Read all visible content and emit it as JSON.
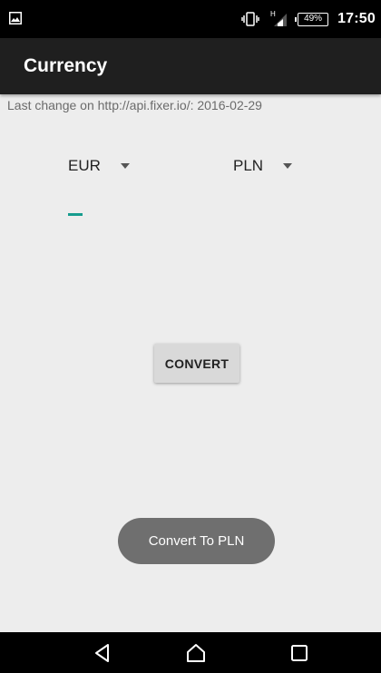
{
  "status_bar": {
    "battery": "49%",
    "time": "17:50",
    "network": "H",
    "icons": [
      "gallery-notification-icon",
      "vibrate-icon",
      "signal-icon",
      "battery-icon"
    ]
  },
  "app_bar": {
    "title": "Currency"
  },
  "main": {
    "last_change": "Last change on http://api.fixer.io/: 2016-02-29",
    "from_currency": "EUR",
    "to_currency": "PLN",
    "amount": "",
    "convert_label": "CONVERT"
  },
  "toast": {
    "text": "Convert To PLN"
  },
  "nav_bar": {
    "icons": [
      "back-icon",
      "home-icon",
      "recent-apps-icon"
    ]
  },
  "colors": {
    "accent": "#169c8e",
    "app_bar": "#1f1f1f",
    "background": "#ededed",
    "toast": "#6f6f6f"
  }
}
